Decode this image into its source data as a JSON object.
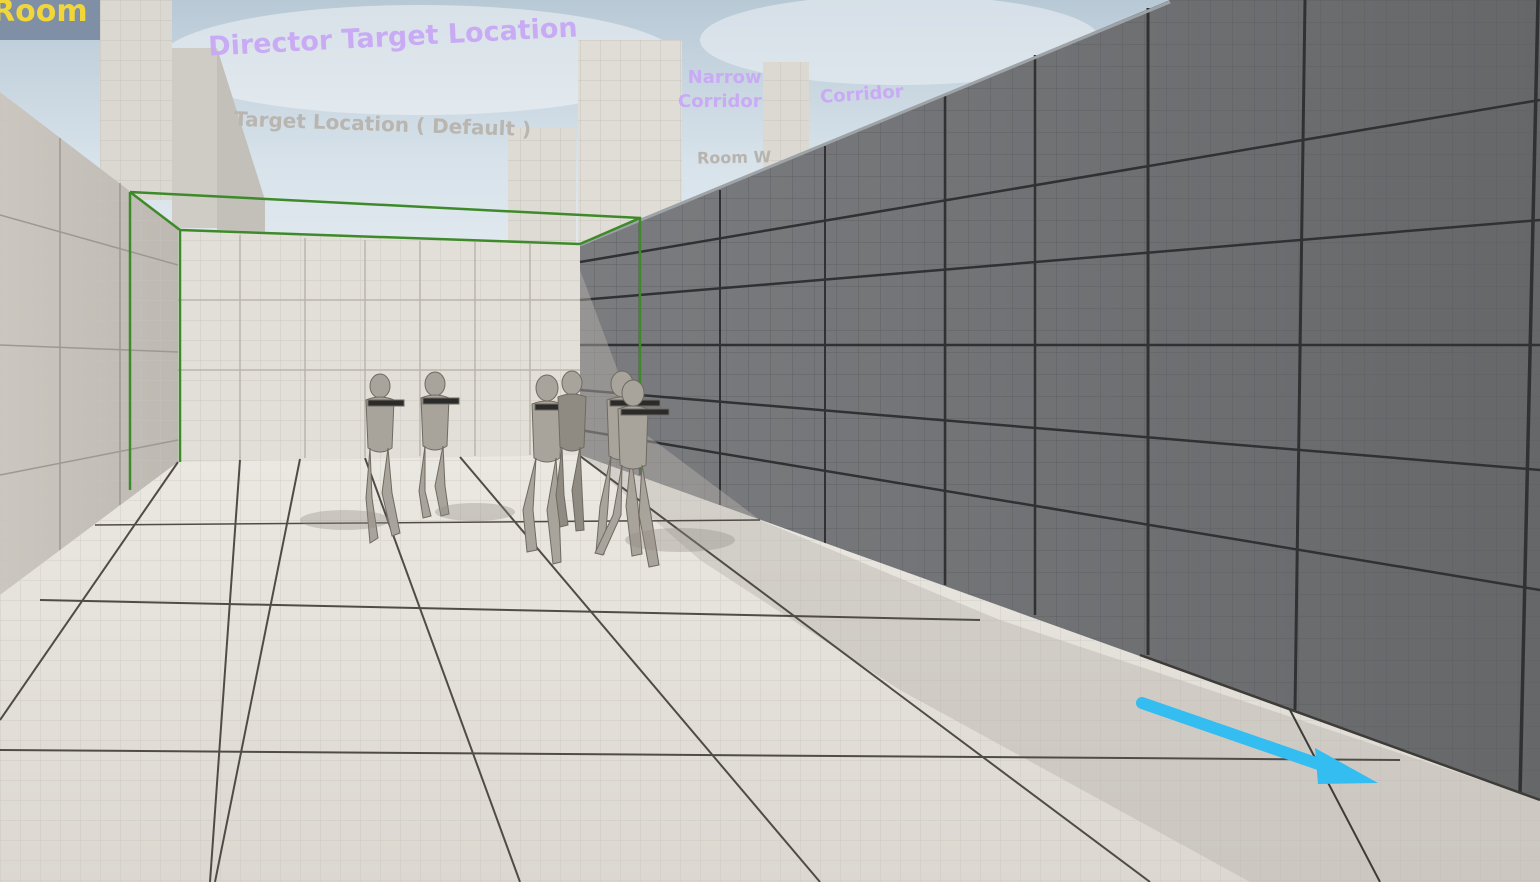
{
  "world_labels": {
    "director_target_location": "Director Target Location",
    "target_location_default": "Target Location ( Default )",
    "room_w": "Room W",
    "room_corner": "Room",
    "narrow_corridor_line1": "Narrow",
    "narrow_corridor_line2": "Corridor",
    "right_sign": "Corridor"
  },
  "scene": {
    "squad_size": 6,
    "icons": {
      "direction_arrow": "arrow-right-icon",
      "trigger_volume": "box-outline-icon"
    },
    "colors": {
      "sky": "#cfdbe4",
      "floor": "#e4e1db",
      "wall_light": "#d9d6d0",
      "wall_dark": "#6b6d70",
      "trigger_box": "#3e8a2a",
      "arrow": "#33bdf0",
      "character": "#a9a49b",
      "label_purple": "#c8a9f5",
      "label_yellow": "#f1d63a"
    }
  }
}
